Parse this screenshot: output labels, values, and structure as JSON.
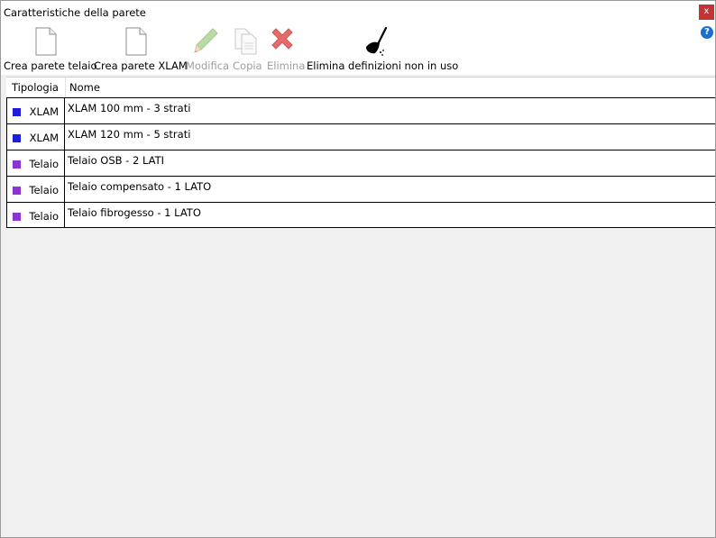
{
  "window": {
    "title": "Caratteristiche della parete",
    "close_glyph": "x",
    "help_glyph": "?"
  },
  "toolbar": {
    "buttons": [
      {
        "label": "Crea parete telaio",
        "icon": "new-document-icon",
        "enabled": true
      },
      {
        "label": "Crea parete XLAM",
        "icon": "new-document-icon",
        "enabled": true
      },
      {
        "label": "Modifica",
        "icon": "pencil-icon",
        "enabled": false
      },
      {
        "label": "Copia",
        "icon": "copy-icon",
        "enabled": false
      },
      {
        "label": "Elimina",
        "icon": "delete-x-icon",
        "enabled": false
      },
      {
        "label": "Elimina definizioni non in uso",
        "icon": "broom-icon",
        "enabled": true
      }
    ]
  },
  "table": {
    "columns": [
      "Tipologia",
      "Nome"
    ],
    "rows": [
      {
        "type": "XLAM",
        "name": "XLAM 100 mm - 3 strati",
        "color": "#1c1fd8"
      },
      {
        "type": "XLAM",
        "name": "XLAM 120 mm - 5 strati",
        "color": "#1c1fd8"
      },
      {
        "type": "Telaio",
        "name": "Telaio OSB - 2 LATI",
        "color": "#8a35cf"
      },
      {
        "type": "Telaio",
        "name": "Telaio compensato - 1 LATO",
        "color": "#8a35cf"
      },
      {
        "type": "Telaio",
        "name": "Telaio fibrogesso - 1 LATO",
        "color": "#8a35cf"
      }
    ]
  },
  "colors": {
    "xlam": "#1c1fd8",
    "telaio": "#8a35cf",
    "close_button": "#c13535",
    "help_icon": "#1e6fc9",
    "delete_icon": "#e56b6b",
    "disabled_text": "#9d9d9d"
  }
}
